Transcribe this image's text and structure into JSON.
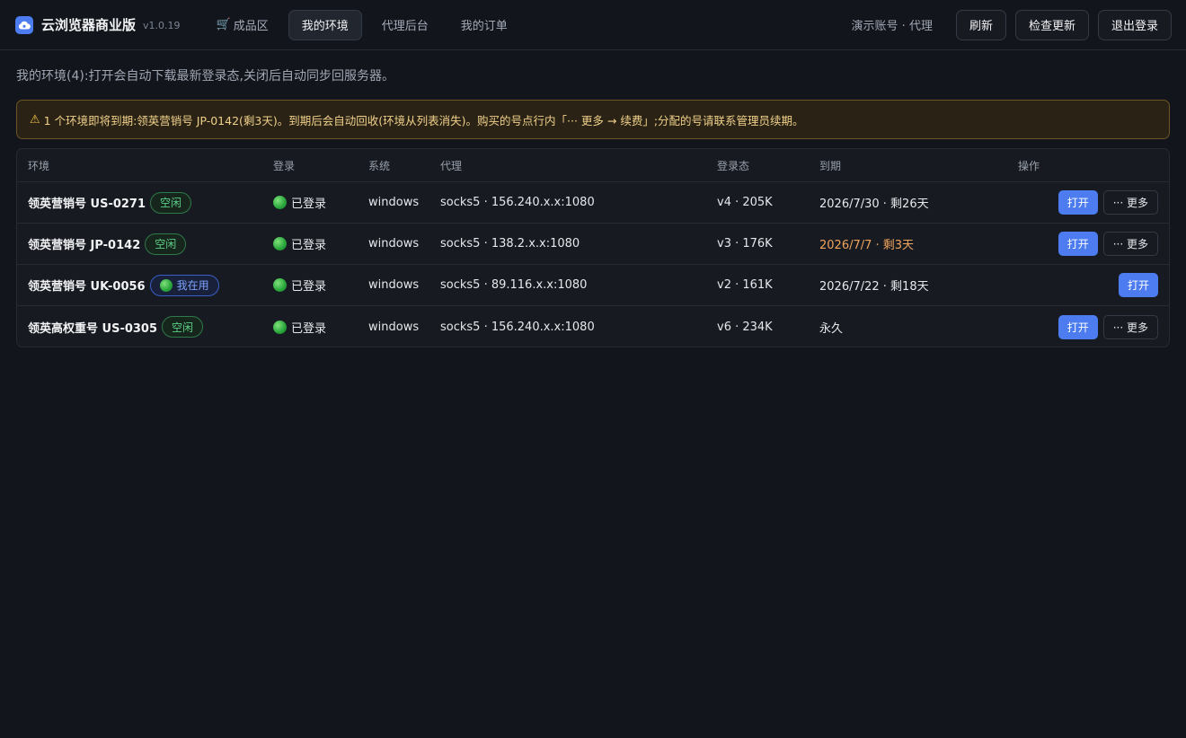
{
  "brand": {
    "name": "云浏览器商业版",
    "version": "v1.0.19",
    "logo_icon": "cloud-icon"
  },
  "nav": {
    "tabs": [
      {
        "label": "成品区",
        "icon": "cart-icon"
      },
      {
        "label": "我的环境",
        "active": true
      },
      {
        "label": "代理后台"
      },
      {
        "label": "我的订单"
      }
    ]
  },
  "header": {
    "account": "演示账号 · 代理",
    "refresh_label": "刷新",
    "check_update_label": "检查更新",
    "logout_label": "退出登录"
  },
  "intro": "我的环境(4):打开会自动下载最新登录态,关闭后自动同步回服务器。",
  "warning": {
    "icon": "warning-icon",
    "text": "1 个环境即将到期:领英营销号 JP-0142(剩3天)。到期后会自动回收(环境从列表消失)。购买的号点行内「··· 更多 → 续费」;分配的号请联系管理员续期。"
  },
  "table": {
    "headers": {
      "env": "环境",
      "login": "登录",
      "system": "系统",
      "proxy": "代理",
      "state": "登录态",
      "expiry": "到期",
      "ops": "操作"
    },
    "open_label": "打开",
    "more_label": "··· 更多",
    "rows": [
      {
        "name": "领英营销号 US-0271",
        "badge": "空闲",
        "login": "已登录",
        "system": "windows",
        "proxy": "socks5 · 156.240.x.x:1080",
        "state": "v4 · 205K",
        "expiry": "2026/7/30 · 剩26天"
      },
      {
        "name": "领英营销号 JP-0142",
        "badge": "空闲",
        "login": "已登录",
        "system": "windows",
        "proxy": "socks5 · 138.2.x.x:1080",
        "state": "v3 · 176K",
        "expiry": "2026/7/7 · 剩3天"
      },
      {
        "name": "领英营销号 UK-0056",
        "badge": "我在用",
        "login": "已登录",
        "system": "windows",
        "proxy": "socks5 · 89.116.x.x:1080",
        "state": "v2 · 161K",
        "expiry": "2026/7/22 · 剩18天"
      },
      {
        "name": "领英高权重号 US-0305",
        "badge": "空闲",
        "login": "已登录",
        "system": "windows",
        "proxy": "socks5 · 156.240.x.x:1080",
        "state": "v6 · 234K",
        "expiry": "永久"
      }
    ]
  },
  "colors": {
    "accent": "#4c7cf0",
    "success": "#5ccf86",
    "warning": "#f0a45e",
    "background": "#12151b"
  }
}
